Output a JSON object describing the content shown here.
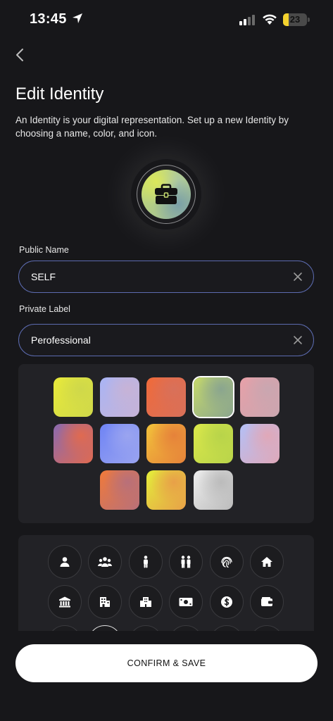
{
  "status": {
    "time": "13:45",
    "battery": "23",
    "battery_level": 0.23
  },
  "page": {
    "title": "Edit Identity",
    "description": "An Identity is your digital representation. Set up a new Identity by choosing a name, color, and icon."
  },
  "avatar": {
    "icon": "briefcase-icon"
  },
  "public_name": {
    "label": "Public Name",
    "value": "SELF"
  },
  "private_label": {
    "label": "Private Label",
    "value": "Perofessional"
  },
  "colors": {
    "selected_index": 3,
    "swatches": [
      {
        "name": "yellow-gradient",
        "colors": [
          "#e8ea3a",
          "#cfd84a"
        ]
      },
      {
        "name": "lavender-blue-gradient",
        "colors": [
          "#a9b4f5",
          "#c7b3d6"
        ]
      },
      {
        "name": "orange-coral-gradient",
        "colors": [
          "#f06a3a",
          "#d8705a"
        ]
      },
      {
        "name": "green-grey-gradient",
        "colors": [
          "#c6d96a",
          "#8aa58f"
        ]
      },
      {
        "name": "pink-blush-gradient",
        "colors": [
          "#e7a0a8",
          "#c9a6b0"
        ]
      },
      {
        "name": "purple-orange-gradient",
        "colors": [
          "#8a6ab0",
          "#e06a50"
        ]
      },
      {
        "name": "blue-periwinkle-gradient",
        "colors": [
          "#6f84f5",
          "#9aa4f0"
        ]
      },
      {
        "name": "amber-orange-gradient",
        "colors": [
          "#f2c23a",
          "#e6823a"
        ]
      },
      {
        "name": "lime-green-gradient",
        "colors": [
          "#dbe84a",
          "#b8d44a"
        ]
      },
      {
        "name": "blue-pink-gradient",
        "colors": [
          "#b3c0f7",
          "#e0a8b8"
        ]
      },
      {
        "name": "orange-red-gradient",
        "colors": [
          "#f07a3a",
          "#b8707a"
        ]
      },
      {
        "name": "yellow-orange-gradient",
        "colors": [
          "#e3ee3a",
          "#e8a048"
        ]
      },
      {
        "name": "silver-gradient",
        "colors": [
          "#eeeeee",
          "#bbbbbb"
        ]
      }
    ]
  },
  "icons": [
    "person-icon",
    "group-icon",
    "standing-person-icon",
    "couple-icon",
    "fingerprint-icon",
    "home-icon",
    "bank-icon",
    "office-building-icon",
    "city-building-icon",
    "banknote-icon",
    "dollar-coin-icon",
    "wallet-icon"
  ],
  "confirm_label": "CONFIRM & SAVE"
}
